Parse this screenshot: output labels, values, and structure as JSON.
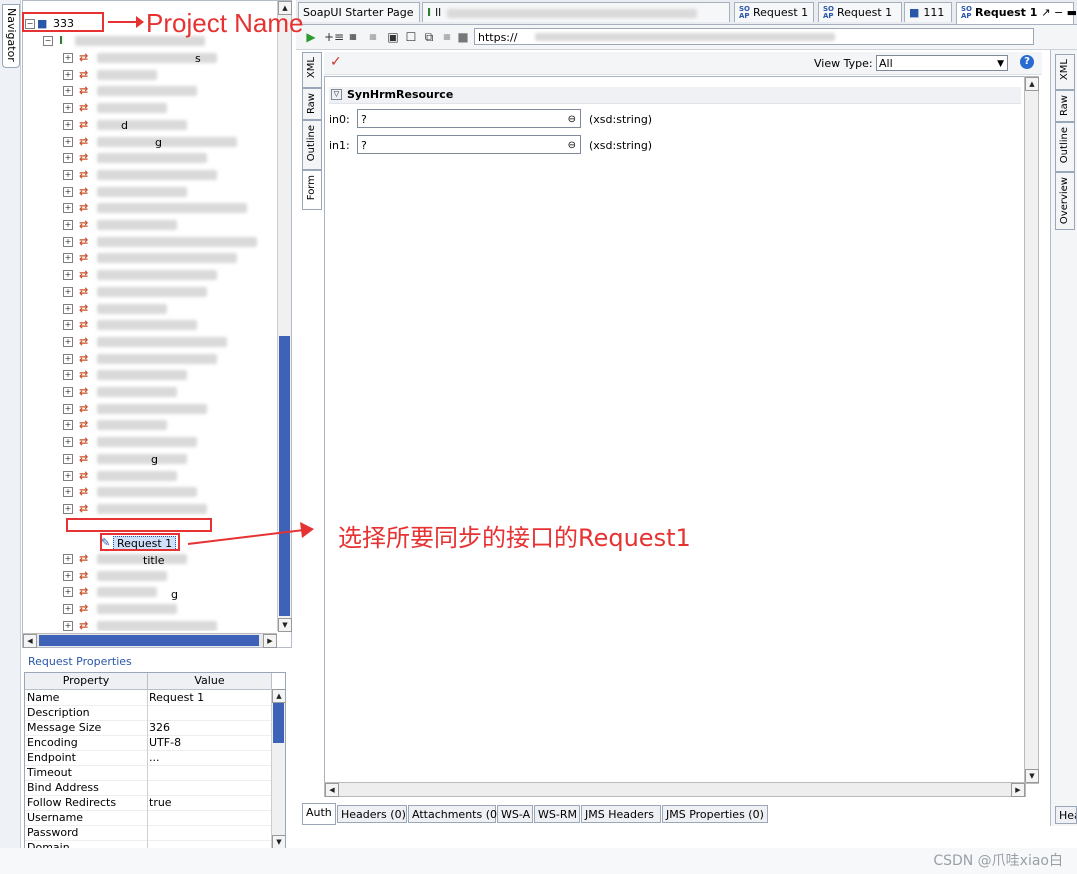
{
  "navigator": {
    "label": "Navigator"
  },
  "tree": {
    "project": "333",
    "partial_labels": [
      "s",
      "d",
      "g",
      "g",
      "Request 1",
      "title",
      "g"
    ],
    "selected_request": "Request 1"
  },
  "properties": {
    "title": "Request Properties",
    "columns": [
      "Property",
      "Value"
    ],
    "rows": [
      {
        "key": "Name",
        "value": "Request 1"
      },
      {
        "key": "Description",
        "value": ""
      },
      {
        "key": "Message Size",
        "value": "326"
      },
      {
        "key": "Encoding",
        "value": "UTF-8"
      },
      {
        "key": "Endpoint",
        "value": "..."
      },
      {
        "key": "Timeout",
        "value": ""
      },
      {
        "key": "Bind Address",
        "value": ""
      },
      {
        "key": "Follow Redirects",
        "value": "true"
      },
      {
        "key": "Username",
        "value": ""
      },
      {
        "key": "Password",
        "value": ""
      },
      {
        "key": "Domain",
        "value": ""
      }
    ]
  },
  "tabs": [
    {
      "label": "SoapUI Starter Page",
      "active": false
    },
    {
      "label": "ll",
      "active": false
    },
    {
      "label": "Request 1",
      "active": false
    },
    {
      "label": "Request 1",
      "active": false
    },
    {
      "label": "111",
      "active": false
    },
    {
      "label": "Request 1",
      "active": true
    }
  ],
  "toolbar": {
    "endpoint": "https://"
  },
  "editor": {
    "side_tabs": [
      "XML",
      "Raw",
      "Outline",
      "Form"
    ],
    "view_type_label": "View Type:",
    "view_type_value": "All",
    "section": "SynHrmResource",
    "fields": [
      {
        "name": "in0:",
        "value": "?",
        "type": "(xsd:string)"
      },
      {
        "name": "in1:",
        "value": "?",
        "type": "(xsd:string)"
      }
    ],
    "bottom_tabs": [
      "Auth",
      "Headers (0)",
      "Attachments (0)",
      "WS-A",
      "WS-RM",
      "JMS Headers",
      "JMS Properties (0)"
    ]
  },
  "right_panel": {
    "side_tabs": [
      "XML",
      "Raw",
      "Outline",
      "Overview"
    ],
    "bottom_tab": "Hea"
  },
  "annotations": {
    "project_name": "Project Name",
    "select_request": "选择所要同步的接口的Request1"
  },
  "watermark": "CSDN @爪哇xiao白",
  "colors": {
    "annotation": "#e63232",
    "selection": "#2a56a8",
    "scrollbar": "#3d62b8"
  }
}
